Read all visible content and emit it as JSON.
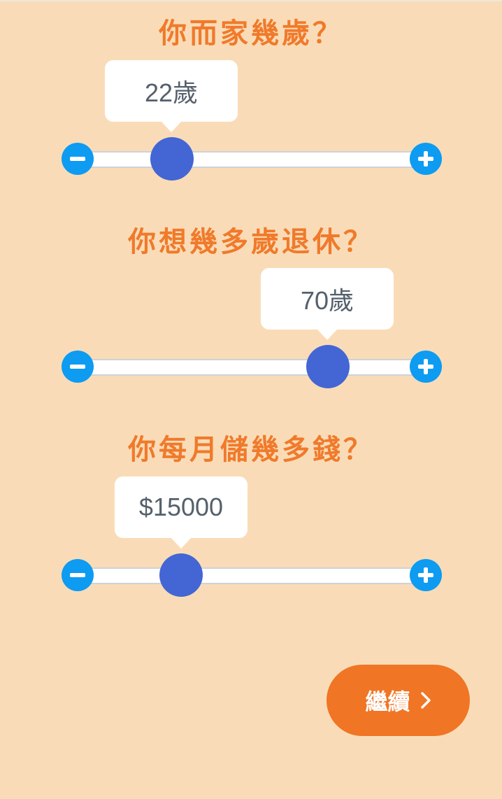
{
  "colors": {
    "background": "#f9dcb7",
    "heading": "#f07a2b",
    "thumb": "#4366d4",
    "step_button": "#0e9bf2",
    "continue_button": "#f07524"
  },
  "questions": [
    {
      "title": "你而家幾歲？",
      "value_label": "22歲",
      "slider_level": 0.25,
      "decrement_icon": "minus-icon",
      "increment_icon": "plus-icon"
    },
    {
      "title": "你想幾多歲退休？",
      "value_label": "70歲",
      "slider_level": 0.71,
      "decrement_icon": "minus-icon",
      "increment_icon": "plus-icon"
    },
    {
      "title": "你每月儲幾多錢？",
      "value_label": "$15000",
      "slider_level": 0.28,
      "decrement_icon": "minus-icon",
      "increment_icon": "plus-icon"
    }
  ],
  "continue_button": {
    "label": "繼續",
    "icon": "chevron-right-icon"
  }
}
